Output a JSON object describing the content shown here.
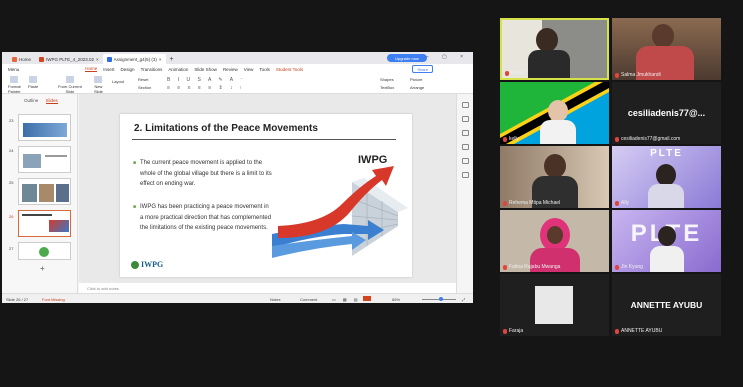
{
  "app": {
    "tabs": [
      {
        "label": "Home",
        "color": "#e8663f"
      },
      {
        "label": "IWPG PLTE_4_2023.02",
        "color": "#d2451e"
      },
      {
        "label": "Assignment_g4(5) (3)",
        "color": "#2b6cdf"
      }
    ],
    "upgrade_label": "Upgrade now",
    "menu": [
      "Menu",
      "Home",
      "Insert",
      "Design",
      "Transitions",
      "Animation",
      "Slide Show",
      "Review",
      "View",
      "Tools",
      "Student Tools"
    ],
    "active_menu": "Home",
    "share_label": "Share"
  },
  "ribbon": {
    "format_painter": "Format\nPainter",
    "paste": "Paste",
    "from_current_slide": "From Current\nSlide",
    "new_slide": "New\nSlide",
    "layout": "Layout",
    "reset": "Reset",
    "section": "Section",
    "shapes": "Shapes",
    "picture": "Picture",
    "textbox": "TextBox",
    "arrange": "Arrange"
  },
  "panel": {
    "tab_outline": "Outline",
    "tab_slides": "Slides",
    "slide_numbers": [
      "23",
      "24",
      "25",
      "26",
      "27"
    ],
    "selected": "26",
    "add_symbol": "+"
  },
  "slide": {
    "title": "2. Limitations of the Peace Movements",
    "bullet1": "The current peace movement is applied to the whole of the global village but there is a limit to its effect on ending war.",
    "bullet2": "IWPG has been practicing a peace movement in a more practical direction that has complemented the limitations of the existing peace movements.",
    "image_label": "IWPG",
    "logo_text": "IWPG"
  },
  "notes_placeholder": "Click to add notes",
  "status": {
    "slide_count": "Slide 26 / 27",
    "font_missing": "Font Missing",
    "notes": "Notes",
    "comment": "Comment",
    "zoom": "65%",
    "zoom_fraction": 0.55
  },
  "participants": [
    {
      "name": "Faraja",
      "muted": true,
      "bg": "#8c8c88",
      "highlighted": true
    },
    {
      "name": "Salma Jmukhandi",
      "muted": true,
      "bg": "#6d4a3a"
    },
    {
      "name": "kelly",
      "muted": true,
      "bg": "#1eb53a"
    },
    {
      "name": "cesiliadenis77@gmail.com",
      "display": "cesiliadenis77@...",
      "muted": true,
      "bg": "#232323"
    },
    {
      "name": "Rehema Mtipa Michael",
      "muted": true,
      "bg": "#b9a48c"
    },
    {
      "name": "Ally",
      "muted": true,
      "bg": "#a99be0",
      "overlay": "PLTE"
    },
    {
      "name": "Fatina Rajabu Mwanga",
      "muted": true,
      "bg": "#c4b8a8"
    },
    {
      "name": "Jin Kyung",
      "muted": true,
      "bg": "#a58ad9",
      "overlay": "PLTE"
    },
    {
      "name": "Faraja",
      "muted": true,
      "bg": "#232323"
    },
    {
      "name": "ANNETTE AYUBU",
      "display": "ANNETTE AYUBU",
      "muted": true,
      "bg": "#232323"
    }
  ]
}
